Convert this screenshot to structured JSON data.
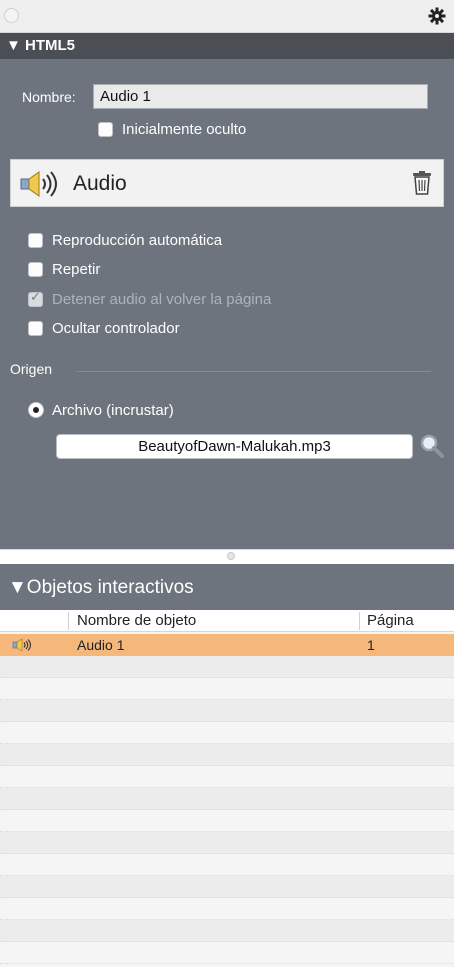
{
  "html5_panel": {
    "section_title": "▼ HTML5",
    "name_label": "Nombre:",
    "name_value": "Audio 1",
    "initially_hidden_label": "Inicialmente oculto",
    "audio_title": "Audio",
    "options": [
      {
        "label": "Reproducción automática",
        "checked": false,
        "enabled": true
      },
      {
        "label": "Repetir",
        "checked": false,
        "enabled": true
      },
      {
        "label": "Detener audio al volver la página",
        "checked": true,
        "enabled": false
      },
      {
        "label": "Ocultar controlador",
        "checked": false,
        "enabled": true
      }
    ],
    "origin_label": "Origen",
    "source_option": "Archivo (incrustar)",
    "file_name": "BeautyofDawn-Malukah.mp3"
  },
  "objects_panel": {
    "section_title": "▼Objetos interactivos",
    "columns": [
      "Nombre de objeto",
      "Página"
    ],
    "rows": [
      {
        "icon": "speaker-icon",
        "name": "Audio 1",
        "page": "1",
        "selected": true
      }
    ]
  },
  "colors": {
    "panel_bg": "#6d747e",
    "header_bg": "#4b4f55",
    "selection": "#f6b77a"
  }
}
